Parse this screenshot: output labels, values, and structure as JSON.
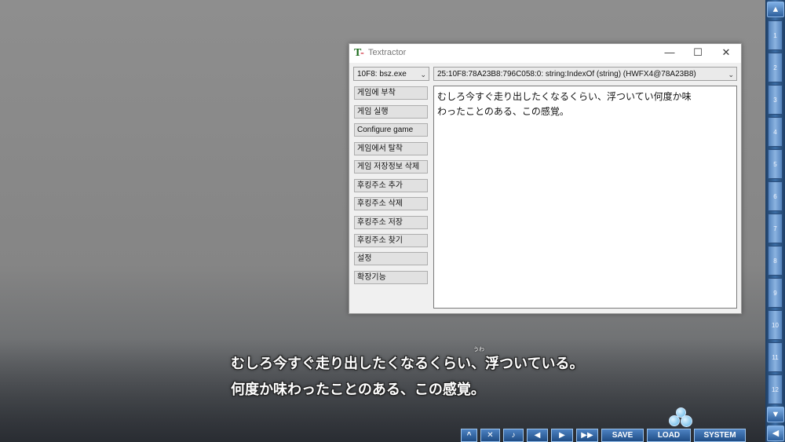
{
  "window": {
    "title": "Textractor",
    "minimize_glyph": "—",
    "maximize_glyph": "☐",
    "close_glyph": "✕",
    "process_selected": "10F8: bsz.exe",
    "thread_selected": "25:10F8:78A23B8:796C058:0: string:IndexOf (string) (HWFX4@78A23B8)",
    "buttons": [
      "게임에 부착",
      "게임 실행",
      "Configure game",
      "게임에서 탈착",
      "게임 저장정보 삭제",
      "후킹주소 추가",
      "후킹주소 삭제",
      "후킹주소 저장",
      "후킹주소 찾기",
      "설정",
      "확장기능"
    ],
    "text_lines": [
      "むしろ今すぐ走り出したくなるくらい、浮ついてい何度か味",
      "わったことのある、この感覚。"
    ]
  },
  "game": {
    "subtitle_lines": [
      "むしろ今すぐ走り出したくなるくらい、浮ついている。",
      "何度か味わったことのある、この感覚。"
    ],
    "ruby": "うわ",
    "controls": {
      "qsave_icon": "^",
      "close_icon": "✕",
      "music_icon": "♪",
      "back_icon": "◀",
      "forward_icon": "▶",
      "skip_icon": "▶▶",
      "save": "SAVE",
      "load": "LOAD",
      "system": "SYSTEM"
    },
    "rail_numbers": [
      "1",
      "2",
      "3",
      "4",
      "5",
      "6",
      "7",
      "8",
      "9",
      "10",
      "11",
      "12"
    ],
    "rail_up": "▲",
    "rail_down": "▼",
    "rail_back": "◀"
  }
}
